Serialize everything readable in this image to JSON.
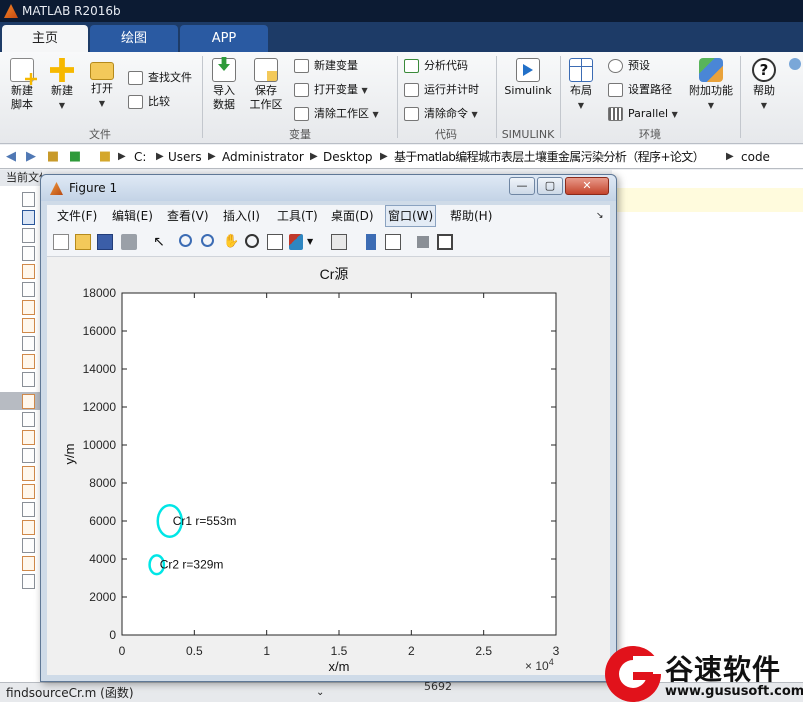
{
  "app": {
    "title": "MATLAB R2016b"
  },
  "tabs": [
    {
      "label": "主页",
      "active": true
    },
    {
      "label": "绘图",
      "active": false
    },
    {
      "label": "APP",
      "active": false
    }
  ],
  "ribbon": {
    "file_group": {
      "label": "文件",
      "new_script": "新建\n脚本",
      "new": "新建",
      "open": "打开",
      "find_files": "查找文件",
      "compare": "比较"
    },
    "variable_group": {
      "label": "变量",
      "import_data": "导入\n数据",
      "save_workspace": "保存\n工作区",
      "new_variable": "新建变量",
      "open_variable": "打开变量",
      "clear_workspace": "清除工作区"
    },
    "code_group": {
      "label": "代码",
      "analyze_code": "分析代码",
      "run_and_time": "运行并计时",
      "clear_commands": "清除命令"
    },
    "simulink_group": {
      "label": "SIMULINK",
      "simulink": "Simulink"
    },
    "environment_group": {
      "label": "环境",
      "layout": "布局",
      "preferences": "预设",
      "set_path": "设置路径",
      "parallel": "Parallel",
      "addons": "附加功能"
    },
    "resources_group": {
      "help": "帮助"
    }
  },
  "address_bar": {
    "path": [
      "C:",
      "Users",
      "Administrator",
      "Desktop",
      "基于matlab编程城市表层土壤重金属污染分析（程序+论文）",
      "code"
    ]
  },
  "left_panel": {
    "header": "当前文件"
  },
  "status_bar": {
    "text": "findsourceCr.m  (函数)"
  },
  "right_panel": {
    "value": "5692"
  },
  "figure": {
    "title": "Figure 1",
    "menu": [
      "文件(F)",
      "编辑(E)",
      "查看(V)",
      "插入(I)",
      "工具(T)",
      "桌面(D)",
      "窗口(W)",
      "帮助(H)"
    ]
  },
  "chart_data": {
    "type": "scatter",
    "title": "Cr源",
    "xlabel": "x/m",
    "ylabel": "y/m",
    "xlim": [
      0,
      30000
    ],
    "ylim": [
      0,
      18000
    ],
    "x_ticks": [
      "0",
      "0.5",
      "1",
      "1.5",
      "2",
      "2.5",
      "3"
    ],
    "x_tick_values": [
      0,
      5000,
      10000,
      15000,
      20000,
      25000,
      30000
    ],
    "x_exponent": "× 10",
    "x_exponent_power": "4",
    "y_ticks": [
      "0",
      "2000",
      "4000",
      "6000",
      "8000",
      "10000",
      "12000",
      "14000",
      "16000",
      "18000"
    ],
    "y_tick_values": [
      0,
      2000,
      4000,
      6000,
      8000,
      10000,
      12000,
      14000,
      16000,
      18000
    ],
    "grid": false,
    "series": [
      {
        "label": "Cr1 r=553m",
        "x": 3300,
        "y": 6000,
        "r": 553,
        "color": "#00e6e6"
      },
      {
        "label": "Cr2 r=329m",
        "x": 2400,
        "y": 3700,
        "r": 329,
        "color": "#00e6e6"
      }
    ]
  },
  "watermark": {
    "brand": "谷速软件",
    "url": "www.gususoft.com"
  }
}
